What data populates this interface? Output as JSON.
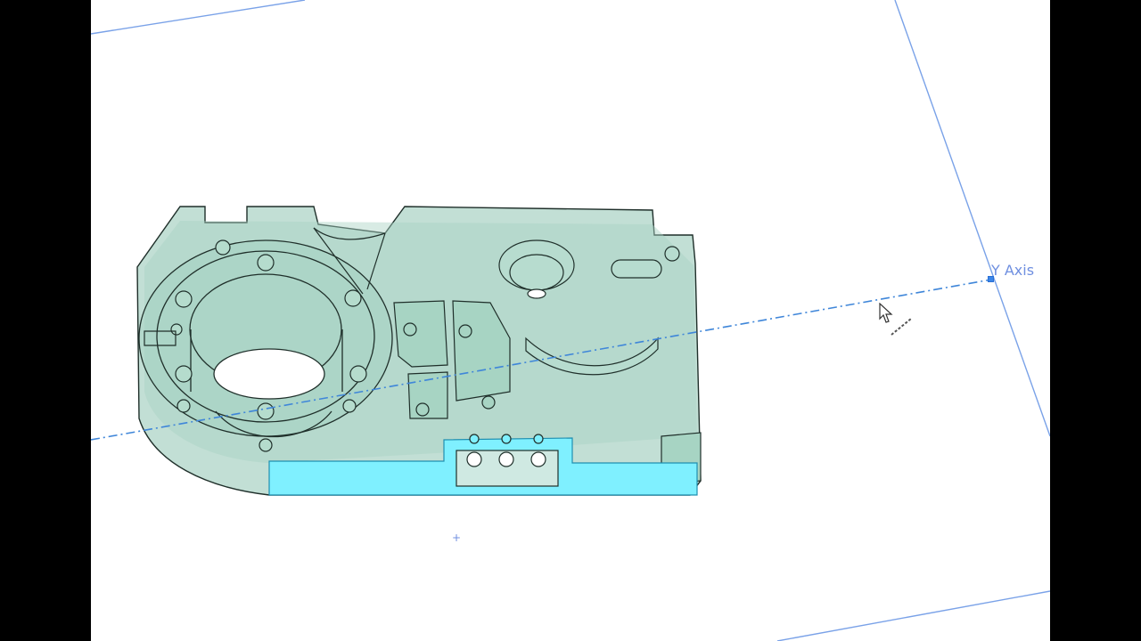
{
  "viewport": {
    "axis_label": "Y Axis",
    "origin_marker": "+"
  },
  "colors": {
    "background": "#ffffff",
    "side_bars": "#000000",
    "part_fill": "#8fc4b2",
    "part_edge": "#1f2f2a",
    "selected_face": "#7ff0ff",
    "plane_edge": "#7aa2e8",
    "axis_line": "#3f86d9"
  },
  "icons": {
    "cursor": "arrow-pointer-icon",
    "axis_handle": "square-handle-icon"
  }
}
